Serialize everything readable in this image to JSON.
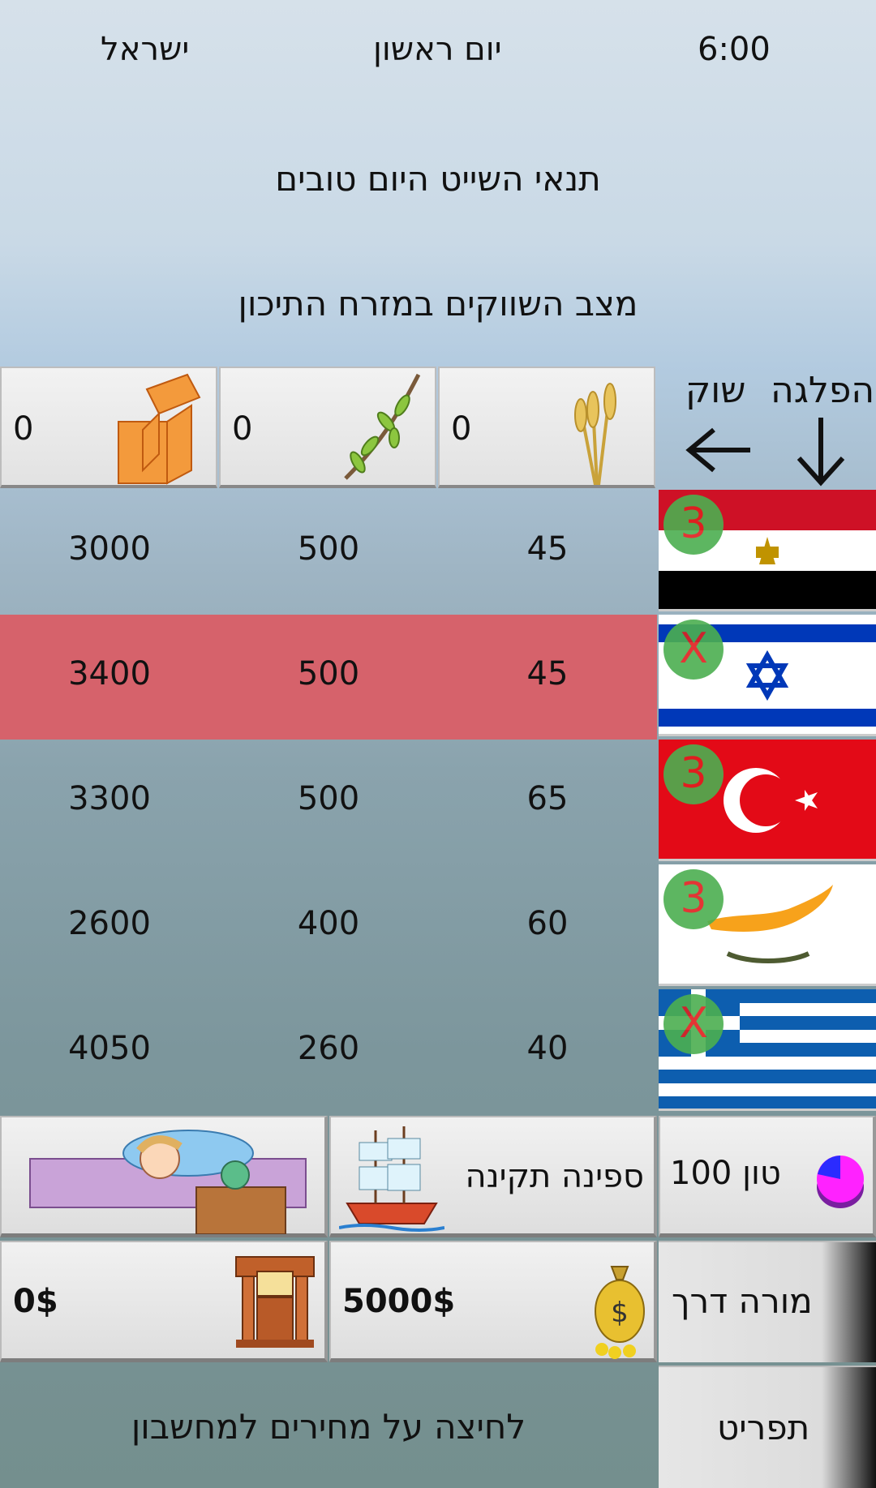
{
  "header": {
    "country": "ישראל",
    "day": "יום ראשון",
    "time": "6:00"
  },
  "sailing_conditions": "תנאי השייט היום טובים",
  "markets_title": "מצב השווקים במזרח התיכון",
  "commodities": [
    {
      "name": "wheat",
      "quantity": "0",
      "icon": "wheat-icon"
    },
    {
      "name": "olive",
      "quantity": "0",
      "icon": "olive-branch-icon"
    },
    {
      "name": "gold",
      "quantity": "0",
      "icon": "gold-bars-icon"
    }
  ],
  "labels": {
    "sail": "הפלגה",
    "market": "שוק"
  },
  "markets": [
    {
      "country": "Egypt",
      "badge": "3",
      "prices": [
        "45",
        "500",
        "3000"
      ],
      "highlighted": false
    },
    {
      "country": "Israel",
      "badge": "X",
      "prices": [
        "45",
        "500",
        "3400"
      ],
      "highlighted": true
    },
    {
      "country": "Turkey",
      "badge": "3",
      "prices": [
        "65",
        "500",
        "3300"
      ],
      "highlighted": false
    },
    {
      "country": "Cyprus",
      "badge": "3",
      "prices": [
        "60",
        "400",
        "2600"
      ],
      "highlighted": false
    },
    {
      "country": "Greece",
      "badge": "X",
      "prices": [
        "40",
        "260",
        "4050"
      ],
      "highlighted": false
    }
  ],
  "status": {
    "capacity": "100 טון",
    "ship_condition": "ספינה תקינה",
    "cash": "5000$",
    "bank": "0$"
  },
  "buttons": {
    "guide": "מורה דרך",
    "menu": "תפריט"
  },
  "hint": "לחיצה על מחירים למחשבון",
  "colors": {
    "highlight_row": "#d6626b",
    "badge_green": "#4caf50",
    "badge_text": "#e12020"
  }
}
